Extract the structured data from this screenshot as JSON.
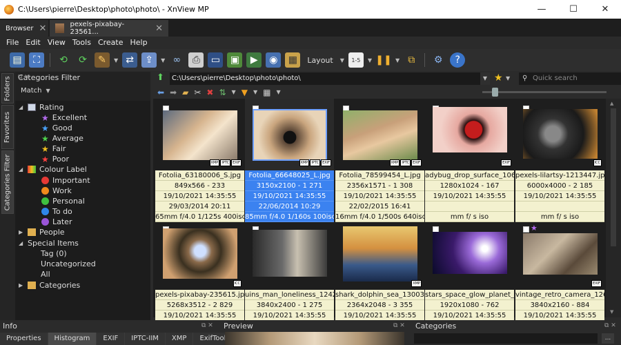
{
  "window": {
    "title": "C:\\Users\\pierre\\Desktop\\photo\\photo\\ - XnView MP",
    "minimize": "—",
    "maximize": "☐",
    "close": "✕"
  },
  "tabs": [
    {
      "label": "Browser"
    },
    {
      "label": "pexels-pixabay-23561..."
    }
  ],
  "menu": [
    "File",
    "Edit",
    "View",
    "Tools",
    "Create",
    "Help"
  ],
  "toolbar": {
    "layout_label": "Layout"
  },
  "side_tabs": [
    "Folders",
    "Favorites",
    "Categories Filter"
  ],
  "categories_panel": {
    "title": "Categories Filter",
    "match_label": "Match",
    "tree": {
      "rating": "Rating",
      "ratings": [
        "Excellent",
        "Good",
        "Average",
        "Fair",
        "Poor"
      ],
      "rating_colors": [
        "#b46cf0",
        "#4aa3ff",
        "#4ed24e",
        "#f0c020",
        "#ff4040"
      ],
      "colour_label": "Colour Label",
      "colours": [
        "Important",
        "Work",
        "Personal",
        "To do",
        "Later"
      ],
      "colour_values": [
        "#e53935",
        "#f08a1c",
        "#3fbf3f",
        "#2f86e8",
        "#9a55d8"
      ],
      "people": "People",
      "special_items": "Special Items",
      "specials": [
        "Tag (0)",
        "Uncategorized",
        "All"
      ],
      "categories": "Categories"
    }
  },
  "address": {
    "path": "C:\\Users\\pierre\\Desktop\\photo\\photo\\",
    "search_placeholder": "Quick search"
  },
  "thumbnails": [
    {
      "name": "Fotolia_63180006_S.jpg",
      "dims": "849x566 - 233",
      "date1": "19/10/2021 14:35:55",
      "date2": "29/03/2014 20:11",
      "exif": "65mm f/4.0 1/125s 400iso",
      "badges": [
        "XMP",
        "IPTC",
        "EXIF"
      ],
      "selected": false
    },
    {
      "name": "Fotolia_66648025_L.jpg",
      "dims": "3150x2100 - 1 271",
      "date1": "19/10/2021 14:35:55",
      "date2": "22/06/2014 10:29",
      "exif": "85mm f/4.0 1/160s 100iso",
      "badges": [
        "XMP",
        "IPTC",
        "EXIF"
      ],
      "selected": true
    },
    {
      "name": "Fotolia_78599454_L.jpg",
      "dims": "2356x1571 - 1 308",
      "date1": "19/10/2021 14:35:55",
      "date2": "22/02/2015 16:41",
      "exif": "16mm f/4.0 1/500s 640iso",
      "badges": [
        "XMP",
        "IPTC",
        "EXIF"
      ],
      "selected": false
    },
    {
      "name": "adybug_drop_surface_1062...",
      "dims": "1280x1024 - 167",
      "date1": "19/10/2021 14:35:55",
      "date2": "",
      "exif": "mm f/ s iso",
      "badges": [
        "EXIF"
      ],
      "selected": false
    },
    {
      "name": "pexels-lilartsy-1213447.jpg",
      "dims": "6000x4000 - 2 185",
      "date1": "19/10/2021 14:35:55",
      "date2": "",
      "exif": "mm f/ s iso",
      "badges": [
        "ICC"
      ],
      "selected": false
    },
    {
      "name": "pexels-pixabay-235615.jpg",
      "dims": "5268x3512 - 2 829",
      "date1": "19/10/2021 14:35:55",
      "badges": [
        "ICC"
      ],
      "selected": false
    },
    {
      "name": "uins_man_loneliness_12427...",
      "dims": "3840x2400 - 1 275",
      "date1": "19/10/2021 14:35:55",
      "badges": [],
      "selected": false
    },
    {
      "name": "shark_dolphin_sea_130036_...",
      "dims": "2364x2048 - 3 355",
      "date1": "19/10/2021 14:35:55",
      "badges": [
        "XMP"
      ],
      "selected": false
    },
    {
      "name": "stars_space_glow_planet_99...",
      "dims": "1920x1080 - 762",
      "date1": "19/10/2021 14:35:55",
      "badges": [],
      "selected": false
    },
    {
      "name": "vintage_retro_camera_1265...",
      "dims": "3840x2160 - 884",
      "date1": "19/10/2021 14:35:55",
      "badges": [
        "EXIF"
      ],
      "selected": false
    }
  ],
  "bottom": {
    "info_title": "Info",
    "preview_title": "Preview",
    "categories_title": "Categories",
    "tabs": [
      "Properties",
      "Histogram",
      "EXIF",
      "IPTC-IIM",
      "XMP",
      "ExifTool"
    ],
    "active_tab": "Histogram",
    "more": "..."
  }
}
